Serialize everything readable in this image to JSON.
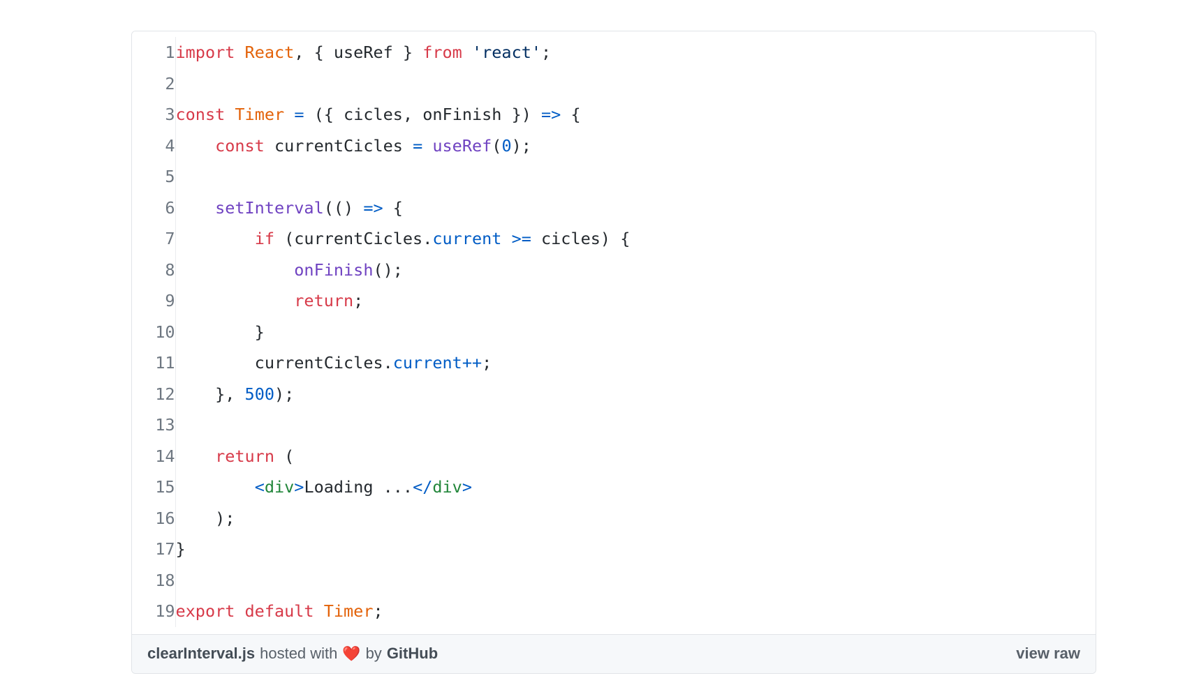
{
  "gist": {
    "filename": "clearInterval.js",
    "footer": {
      "filename": "clearInterval.js",
      "hosted_with": "hosted with",
      "heart": "❤️",
      "by": "by",
      "host": "GitHub",
      "view_raw": "view raw"
    },
    "lines": [
      {
        "n": "1",
        "tokens": [
          {
            "t": "import",
            "c": "k"
          },
          {
            "t": " ",
            "c": "p"
          },
          {
            "t": "React",
            "c": "e"
          },
          {
            "t": ", { useRef } ",
            "c": "p"
          },
          {
            "t": "from",
            "c": "k"
          },
          {
            "t": " ",
            "c": "p"
          },
          {
            "t": "'react'",
            "c": "s"
          },
          {
            "t": ";",
            "c": "p"
          }
        ]
      },
      {
        "n": "2",
        "tokens": []
      },
      {
        "n": "3",
        "tokens": [
          {
            "t": "const",
            "c": "k"
          },
          {
            "t": " ",
            "c": "p"
          },
          {
            "t": "Timer",
            "c": "e"
          },
          {
            "t": " ",
            "c": "p"
          },
          {
            "t": "=",
            "c": "c"
          },
          {
            "t": " ({ cicles, onFinish }) ",
            "c": "p"
          },
          {
            "t": "=>",
            "c": "c"
          },
          {
            "t": " {",
            "c": "p"
          }
        ]
      },
      {
        "n": "4",
        "tokens": [
          {
            "t": "    ",
            "c": "p"
          },
          {
            "t": "const",
            "c": "k"
          },
          {
            "t": " currentCicles ",
            "c": "p"
          },
          {
            "t": "=",
            "c": "c"
          },
          {
            "t": " ",
            "c": "p"
          },
          {
            "t": "useRef",
            "c": "f"
          },
          {
            "t": "(",
            "c": "p"
          },
          {
            "t": "0",
            "c": "c"
          },
          {
            "t": ");",
            "c": "p"
          }
        ]
      },
      {
        "n": "5",
        "tokens": []
      },
      {
        "n": "6",
        "tokens": [
          {
            "t": "    ",
            "c": "p"
          },
          {
            "t": "setInterval",
            "c": "f"
          },
          {
            "t": "(() ",
            "c": "p"
          },
          {
            "t": "=>",
            "c": "c"
          },
          {
            "t": " {",
            "c": "p"
          }
        ]
      },
      {
        "n": "7",
        "tokens": [
          {
            "t": "        ",
            "c": "p"
          },
          {
            "t": "if",
            "c": "k"
          },
          {
            "t": " (currentCicles.",
            "c": "p"
          },
          {
            "t": "current",
            "c": "c"
          },
          {
            "t": " ",
            "c": "p"
          },
          {
            "t": ">=",
            "c": "c"
          },
          {
            "t": " cicles) {",
            "c": "p"
          }
        ]
      },
      {
        "n": "8",
        "tokens": [
          {
            "t": "            ",
            "c": "p"
          },
          {
            "t": "onFinish",
            "c": "f"
          },
          {
            "t": "();",
            "c": "p"
          }
        ]
      },
      {
        "n": "9",
        "tokens": [
          {
            "t": "            ",
            "c": "p"
          },
          {
            "t": "return",
            "c": "k"
          },
          {
            "t": ";",
            "c": "p"
          }
        ]
      },
      {
        "n": "10",
        "tokens": [
          {
            "t": "        }",
            "c": "p"
          }
        ]
      },
      {
        "n": "11",
        "tokens": [
          {
            "t": "        currentCicles.",
            "c": "p"
          },
          {
            "t": "current",
            "c": "c"
          },
          {
            "t": "++",
            "c": "c"
          },
          {
            "t": ";",
            "c": "p"
          }
        ]
      },
      {
        "n": "12",
        "tokens": [
          {
            "t": "    }, ",
            "c": "p"
          },
          {
            "t": "500",
            "c": "c"
          },
          {
            "t": ");",
            "c": "p"
          }
        ]
      },
      {
        "n": "13",
        "tokens": []
      },
      {
        "n": "14",
        "tokens": [
          {
            "t": "    ",
            "c": "p"
          },
          {
            "t": "return",
            "c": "k"
          },
          {
            "t": " (",
            "c": "p"
          }
        ]
      },
      {
        "n": "15",
        "tokens": [
          {
            "t": "        ",
            "c": "p"
          },
          {
            "t": "<",
            "c": "c"
          },
          {
            "t": "div",
            "c": "t"
          },
          {
            "t": ">",
            "c": "c"
          },
          {
            "t": "Loading ...",
            "c": "p"
          },
          {
            "t": "</",
            "c": "c"
          },
          {
            "t": "div",
            "c": "t"
          },
          {
            "t": ">",
            "c": "c"
          }
        ]
      },
      {
        "n": "16",
        "tokens": [
          {
            "t": "    );",
            "c": "p"
          }
        ]
      },
      {
        "n": "17",
        "tokens": [
          {
            "t": "}",
            "c": "p"
          }
        ]
      },
      {
        "n": "18",
        "tokens": []
      },
      {
        "n": "19",
        "tokens": [
          {
            "t": "export default",
            "c": "k"
          },
          {
            "t": " ",
            "c": "p"
          },
          {
            "t": "Timer",
            "c": "e"
          },
          {
            "t": ";",
            "c": "p"
          }
        ]
      }
    ]
  }
}
